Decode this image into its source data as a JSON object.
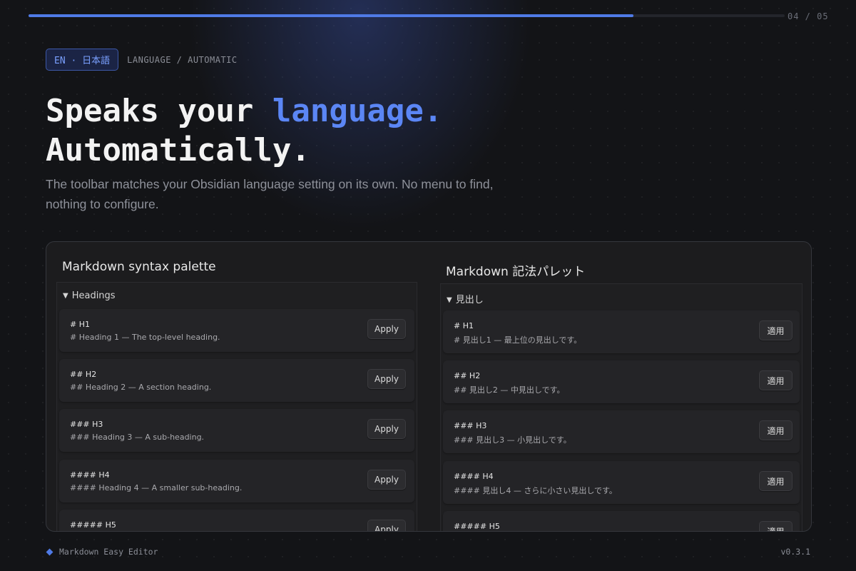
{
  "progress": {
    "fraction": 0.8,
    "counter": "04 / 05"
  },
  "tag": {
    "badge": "EN · 日本語",
    "caption": "LANGUAGE / AUTOMATIC"
  },
  "headline": {
    "part1": "Speaks your ",
    "accent": "language.",
    "line2": "Automatically."
  },
  "subtitle": "The toolbar matches your Obsidian language setting on its own. No menu to find, nothing to configure.",
  "palette_en": {
    "title": "Markdown syntax palette",
    "section": "Headings",
    "items": [
      {
        "title": "# H1",
        "desc": "# Heading 1 — The top-level heading.",
        "button": "Apply"
      },
      {
        "title": "## H2",
        "desc": "## Heading 2 — A section heading.",
        "button": "Apply"
      },
      {
        "title": "### H3",
        "desc": "### Heading 3 — A sub-heading.",
        "button": "Apply"
      },
      {
        "title": "#### H4",
        "desc": "#### Heading 4 — A smaller sub-heading.",
        "button": "Apply"
      },
      {
        "title": "##### H5",
        "desc": "",
        "button": "Apply"
      }
    ]
  },
  "palette_ja": {
    "title": "Markdown 記法パレット",
    "section": "見出し",
    "items": [
      {
        "title": "# H1",
        "desc": "# 見出し1 — 最上位の見出しです。",
        "button": "適用"
      },
      {
        "title": "## H2",
        "desc": "## 見出し2 — 中見出しです。",
        "button": "適用"
      },
      {
        "title": "### H3",
        "desc": "### 見出し3 — 小見出しです。",
        "button": "適用"
      },
      {
        "title": "#### H4",
        "desc": "#### 見出し4 — さらに小さい見出しです。",
        "button": "適用"
      },
      {
        "title": "##### H5",
        "desc": "",
        "button": "適用"
      }
    ]
  },
  "footer": {
    "brand": "Markdown Easy Editor",
    "version": "v0.3.1"
  },
  "colors": {
    "accent": "#5b86f5",
    "background": "#131417"
  }
}
